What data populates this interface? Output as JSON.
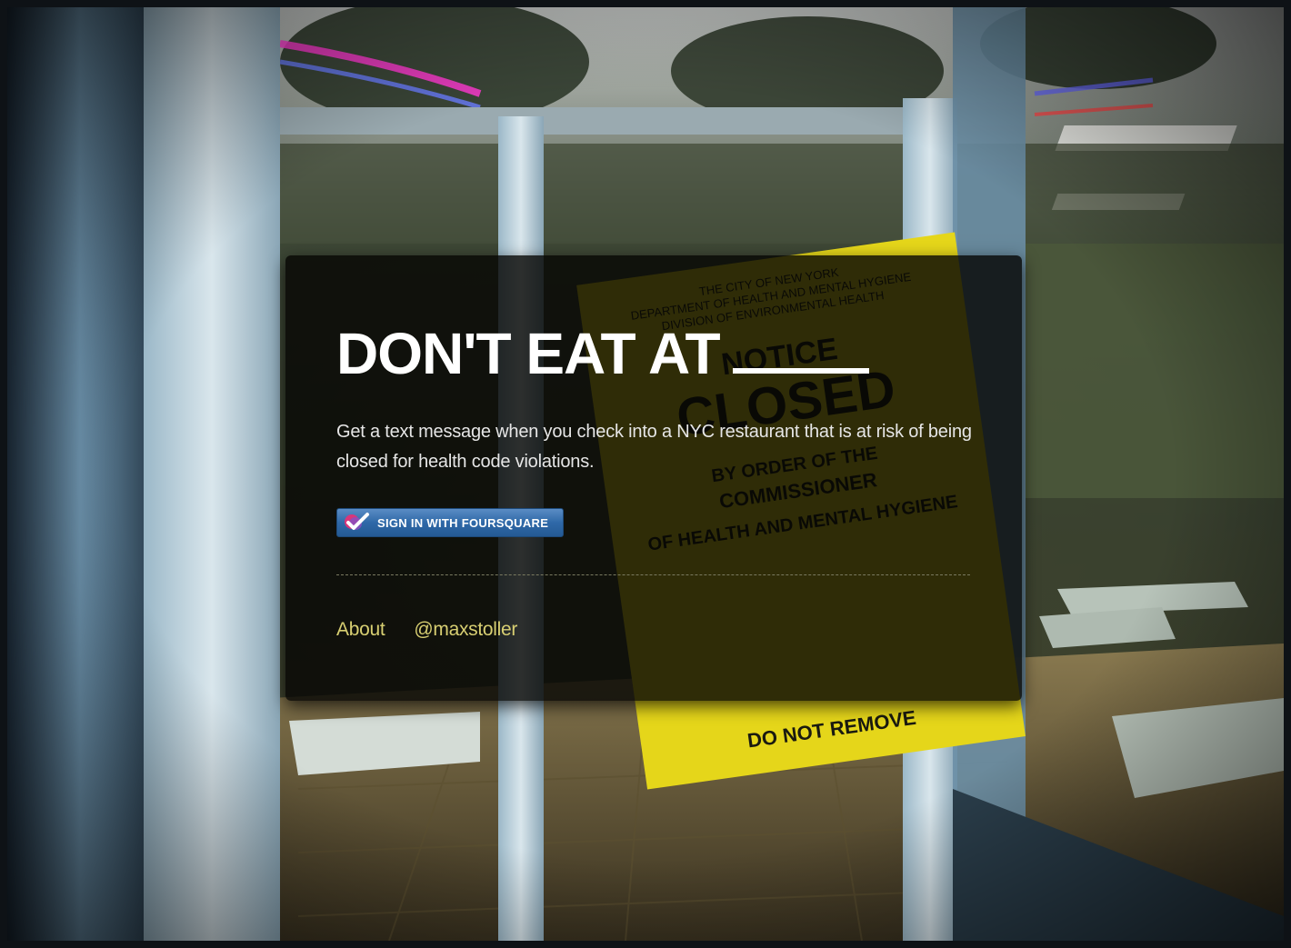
{
  "hero": {
    "headline": "DON'T EAT AT",
    "subtitle": "Get a text message when you check into a NYC restaurant that is at risk of being closed for health code violations."
  },
  "signin": {
    "label": "SIGN IN WITH FOURSQUARE",
    "icon": "foursquare-check-icon"
  },
  "footer_links": [
    {
      "label": "About"
    },
    {
      "label": "@maxstoller"
    }
  ],
  "notice_sign": {
    "lines": [
      "THE CITY OF NEW YORK",
      "DEPARTMENT OF HEALTH AND MENTAL HYGIENE",
      "DIVISION OF ENVIRONMENTAL HEALTH",
      "NOTICE",
      "CLOSED",
      "BY ORDER OF THE",
      "COMMISSIONER",
      "OF HEALTH AND MENTAL HYGIENE",
      "DO NOT REMOVE"
    ]
  },
  "colors": {
    "link": "#d8cf72",
    "button": "#2f69a8",
    "sign": "#f2e21c"
  }
}
